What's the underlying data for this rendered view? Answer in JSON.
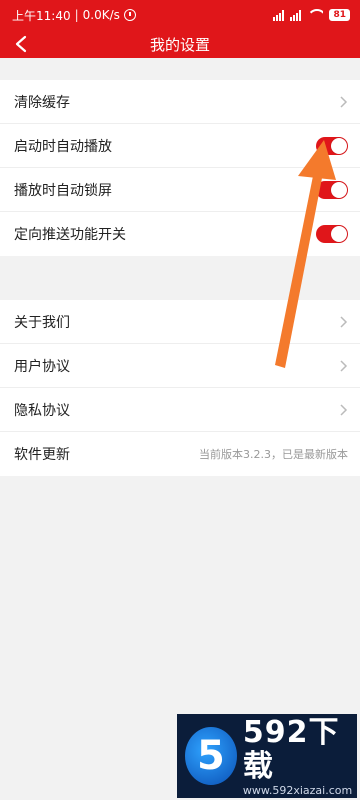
{
  "statusbar": {
    "time": "上午11:40",
    "speed": "0.0K/s",
    "battery": "81"
  },
  "navbar": {
    "title": "我的设置"
  },
  "group1": [
    {
      "label": "清除缓存",
      "control": "chevron"
    },
    {
      "label": "启动时自动播放",
      "control": "toggle",
      "on": true
    },
    {
      "label": "播放时自动锁屏",
      "control": "toggle",
      "on": true
    },
    {
      "label": "定向推送功能开关",
      "control": "toggle",
      "on": true
    }
  ],
  "group2": [
    {
      "label": "关于我们",
      "control": "chevron"
    },
    {
      "label": "用户协议",
      "control": "chevron"
    },
    {
      "label": "隐私协议",
      "control": "chevron"
    },
    {
      "label": "软件更新",
      "control": "text",
      "value": "当前版本3.2.3，已是最新版本"
    }
  ],
  "watermark": {
    "logo_glyph": "5",
    "brand": "592下载",
    "url": "www.592xiazai.com"
  },
  "colors": {
    "accent": "#e0161a",
    "annotation_arrow": "#f47a2c"
  }
}
